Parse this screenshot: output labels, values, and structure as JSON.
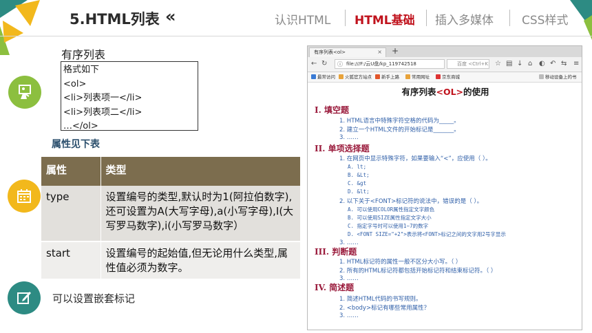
{
  "header": {
    "title": "5.HTML列表",
    "chevron": "«",
    "nav": [
      "认识HTML",
      "HTML基础",
      "插入多媒体",
      "CSS样式"
    ],
    "active_index": 1
  },
  "colors": {
    "accent_red": "#c0121c",
    "teal": "#2d8b83",
    "yellow": "#f2b81c",
    "green": "#8cbf3f",
    "table_header": "#7c6d4e"
  },
  "sidebar_icons": [
    "presentation-icon",
    "calendar-icon",
    "edit-icon"
  ],
  "content": {
    "ordered_list_title": "有序列表",
    "code_lines": [
      "格式如下",
      "<ol>",
      "<li>列表项一</li>",
      "<li>列表项二</li>",
      "…</ol>"
    ],
    "attr_heading": "属性见下表",
    "table": {
      "headers": [
        "属性",
        "类型"
      ],
      "rows": [
        [
          "type",
          "设置编号的类型,默认时为1(阿拉伯数字),还可设置为A(大写字母),a(小写字母),I(大写罗马数字),i(小写罗马数字）"
        ],
        [
          "start",
          "设置编号的起始值,但无论用什么类型,属性值必须为数字。"
        ]
      ]
    },
    "nested_note": "可以设置嵌套标记"
  },
  "browser": {
    "tab_title": "有序列表<ol>",
    "tab_close": "×",
    "new_tab": "+",
    "url": "file:///F:/云U盘/kp_119742518",
    "search_placeholder": "百度 <Ctrl+K>",
    "bookmarks": [
      "最常访问",
      "火狐官方站点",
      "新手上路",
      "常用网址",
      "京东商城",
      "移动设备上的书"
    ],
    "doc": {
      "title_pre": "有序列表",
      "title_tag": "<OL>",
      "title_post": "的使用",
      "sections": [
        {
          "label": "I.  填空题",
          "items": [
            "1. HTML语言中特殊字符空格的代码为_____。",
            "2. 建立一个HTML文件的开始标记是_______。",
            "3. ……"
          ]
        },
        {
          "label": "II.  单项选择题",
          "items": [
            "1. 在网页中显示特殊字符，如果要输入“<”，应使用（ ）。",
            "2. 以下关于<FONT>标记符的说法中，错误的是（ ）。",
            "3. ……"
          ],
          "options1": [
            "A.  lt;",
            "B.  &Lt;",
            "C.  &gt",
            "D.  &lt;"
          ],
          "options2": [
            "A.  可以使用COLOR属性指定文字颜色",
            "B.  可以使用SIZE属性指定文字大小",
            "C.  指定字号时可以使用1~7的数字",
            "D.  <FONT SIZE=\"+2\">表示将<FONT>标记之间的文字用2号字显示"
          ]
        },
        {
          "label": "III.  判断题",
          "items": [
            "1. HTML标记符的属性一般不区分大小写。（ ）",
            "2. 所有的HTML标记符都包括开始标记符和结束标记符。（ ）",
            "3. ……"
          ]
        },
        {
          "label": "IV.  简述题",
          "items": [
            "1. 简述HTML代码的书写规则。",
            "2. <body>标记有哪些常用属性？",
            "3. ……"
          ]
        }
      ]
    }
  }
}
